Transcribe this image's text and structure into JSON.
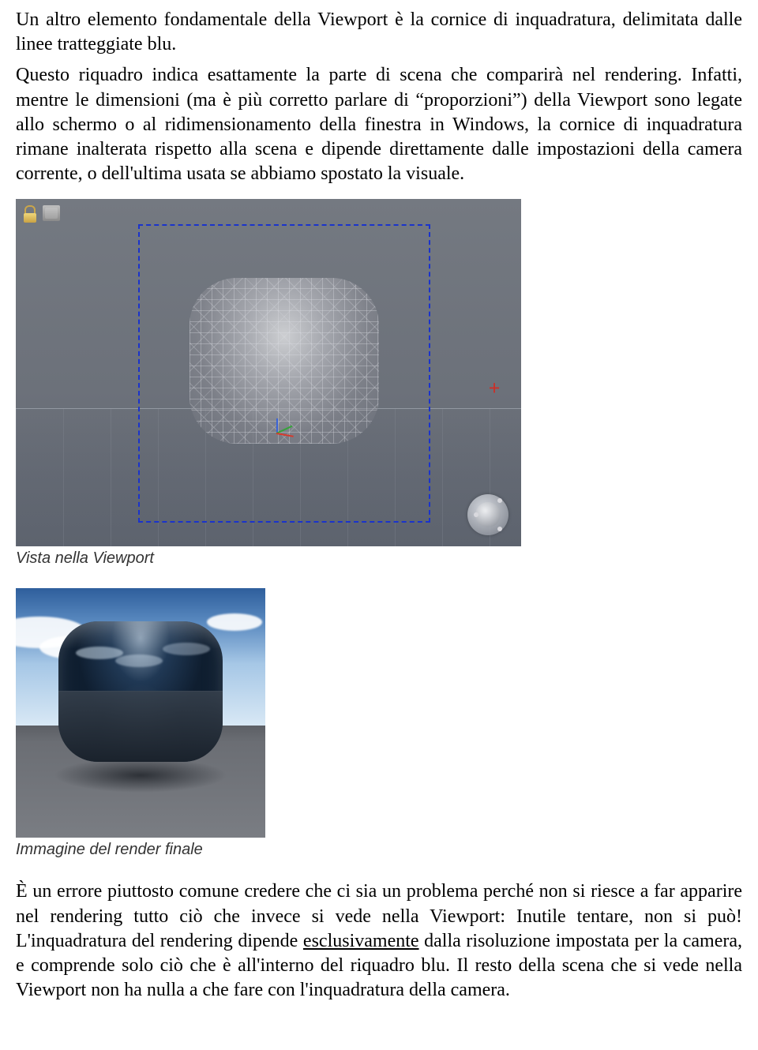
{
  "paragraphs": {
    "p1": "Un altro elemento fondamentale della Viewport è la cornice di inquadratura, delimitata dalle linee tratteggiate blu.",
    "p2": "Questo riquadro indica esattamente la parte di scena che comparirà nel rendering. Infatti, mentre le dimensioni (ma è più corretto parlare di “proporzioni”) della Viewport sono legate allo schermo o al ridimensionamento della finestra in Windows, la cornice di inquadratura rimane inalterata rispetto alla scena e dipende direttamente dalle impostazioni della camera corrente, o dell'ultima usata se abbiamo spostato la visuale."
  },
  "captions": {
    "viewport": "Vista nella Viewport",
    "render": "Immagine del render finale"
  },
  "closing": {
    "pre": "È un errore piuttosto comune credere che ci sia un problema perché non si riesce a far apparire nel rendering tutto ciò che invece si vede nella Viewport: Inutile tentare, non si può! L'inquadratura del rendering dipende ",
    "underlined": "esclusivamente",
    "post": " dalla risoluzione impostata per la camera, e comprende solo ciò che è all'interno del riquadro blu. Il resto della scena che si vede nella Viewport non ha nulla a che fare con l'inquadratura della camera."
  }
}
